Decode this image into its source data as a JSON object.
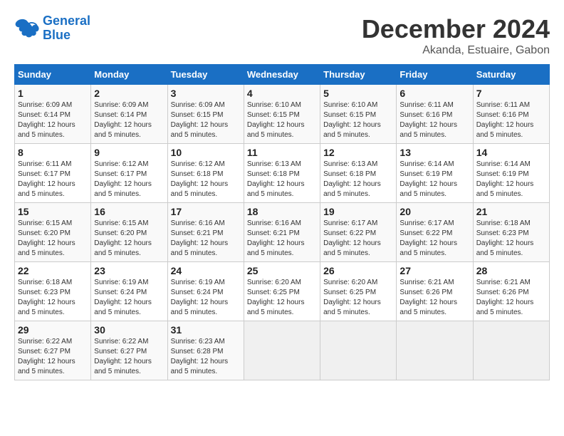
{
  "logo": {
    "text_general": "General",
    "text_blue": "Blue"
  },
  "title": "December 2024",
  "subtitle": "Akanda, Estuaire, Gabon",
  "days_of_week": [
    "Sunday",
    "Monday",
    "Tuesday",
    "Wednesday",
    "Thursday",
    "Friday",
    "Saturday"
  ],
  "weeks": [
    [
      {
        "day": "1",
        "sunrise": "6:09 AM",
        "sunset": "6:14 PM",
        "daylight": "12 hours and 5 minutes."
      },
      {
        "day": "2",
        "sunrise": "6:09 AM",
        "sunset": "6:14 PM",
        "daylight": "12 hours and 5 minutes."
      },
      {
        "day": "3",
        "sunrise": "6:09 AM",
        "sunset": "6:15 PM",
        "daylight": "12 hours and 5 minutes."
      },
      {
        "day": "4",
        "sunrise": "6:10 AM",
        "sunset": "6:15 PM",
        "daylight": "12 hours and 5 minutes."
      },
      {
        "day": "5",
        "sunrise": "6:10 AM",
        "sunset": "6:15 PM",
        "daylight": "12 hours and 5 minutes."
      },
      {
        "day": "6",
        "sunrise": "6:11 AM",
        "sunset": "6:16 PM",
        "daylight": "12 hours and 5 minutes."
      },
      {
        "day": "7",
        "sunrise": "6:11 AM",
        "sunset": "6:16 PM",
        "daylight": "12 hours and 5 minutes."
      }
    ],
    [
      {
        "day": "8",
        "sunrise": "6:11 AM",
        "sunset": "6:17 PM",
        "daylight": "12 hours and 5 minutes."
      },
      {
        "day": "9",
        "sunrise": "6:12 AM",
        "sunset": "6:17 PM",
        "daylight": "12 hours and 5 minutes."
      },
      {
        "day": "10",
        "sunrise": "6:12 AM",
        "sunset": "6:18 PM",
        "daylight": "12 hours and 5 minutes."
      },
      {
        "day": "11",
        "sunrise": "6:13 AM",
        "sunset": "6:18 PM",
        "daylight": "12 hours and 5 minutes."
      },
      {
        "day": "12",
        "sunrise": "6:13 AM",
        "sunset": "6:18 PM",
        "daylight": "12 hours and 5 minutes."
      },
      {
        "day": "13",
        "sunrise": "6:14 AM",
        "sunset": "6:19 PM",
        "daylight": "12 hours and 5 minutes."
      },
      {
        "day": "14",
        "sunrise": "6:14 AM",
        "sunset": "6:19 PM",
        "daylight": "12 hours and 5 minutes."
      }
    ],
    [
      {
        "day": "15",
        "sunrise": "6:15 AM",
        "sunset": "6:20 PM",
        "daylight": "12 hours and 5 minutes."
      },
      {
        "day": "16",
        "sunrise": "6:15 AM",
        "sunset": "6:20 PM",
        "daylight": "12 hours and 5 minutes."
      },
      {
        "day": "17",
        "sunrise": "6:16 AM",
        "sunset": "6:21 PM",
        "daylight": "12 hours and 5 minutes."
      },
      {
        "day": "18",
        "sunrise": "6:16 AM",
        "sunset": "6:21 PM",
        "daylight": "12 hours and 5 minutes."
      },
      {
        "day": "19",
        "sunrise": "6:17 AM",
        "sunset": "6:22 PM",
        "daylight": "12 hours and 5 minutes."
      },
      {
        "day": "20",
        "sunrise": "6:17 AM",
        "sunset": "6:22 PM",
        "daylight": "12 hours and 5 minutes."
      },
      {
        "day": "21",
        "sunrise": "6:18 AM",
        "sunset": "6:23 PM",
        "daylight": "12 hours and 5 minutes."
      }
    ],
    [
      {
        "day": "22",
        "sunrise": "6:18 AM",
        "sunset": "6:23 PM",
        "daylight": "12 hours and 5 minutes."
      },
      {
        "day": "23",
        "sunrise": "6:19 AM",
        "sunset": "6:24 PM",
        "daylight": "12 hours and 5 minutes."
      },
      {
        "day": "24",
        "sunrise": "6:19 AM",
        "sunset": "6:24 PM",
        "daylight": "12 hours and 5 minutes."
      },
      {
        "day": "25",
        "sunrise": "6:20 AM",
        "sunset": "6:25 PM",
        "daylight": "12 hours and 5 minutes."
      },
      {
        "day": "26",
        "sunrise": "6:20 AM",
        "sunset": "6:25 PM",
        "daylight": "12 hours and 5 minutes."
      },
      {
        "day": "27",
        "sunrise": "6:21 AM",
        "sunset": "6:26 PM",
        "daylight": "12 hours and 5 minutes."
      },
      {
        "day": "28",
        "sunrise": "6:21 AM",
        "sunset": "6:26 PM",
        "daylight": "12 hours and 5 minutes."
      }
    ],
    [
      {
        "day": "29",
        "sunrise": "6:22 AM",
        "sunset": "6:27 PM",
        "daylight": "12 hours and 5 minutes."
      },
      {
        "day": "30",
        "sunrise": "6:22 AM",
        "sunset": "6:27 PM",
        "daylight": "12 hours and 5 minutes."
      },
      {
        "day": "31",
        "sunrise": "6:23 AM",
        "sunset": "6:28 PM",
        "daylight": "12 hours and 5 minutes."
      },
      null,
      null,
      null,
      null
    ]
  ]
}
